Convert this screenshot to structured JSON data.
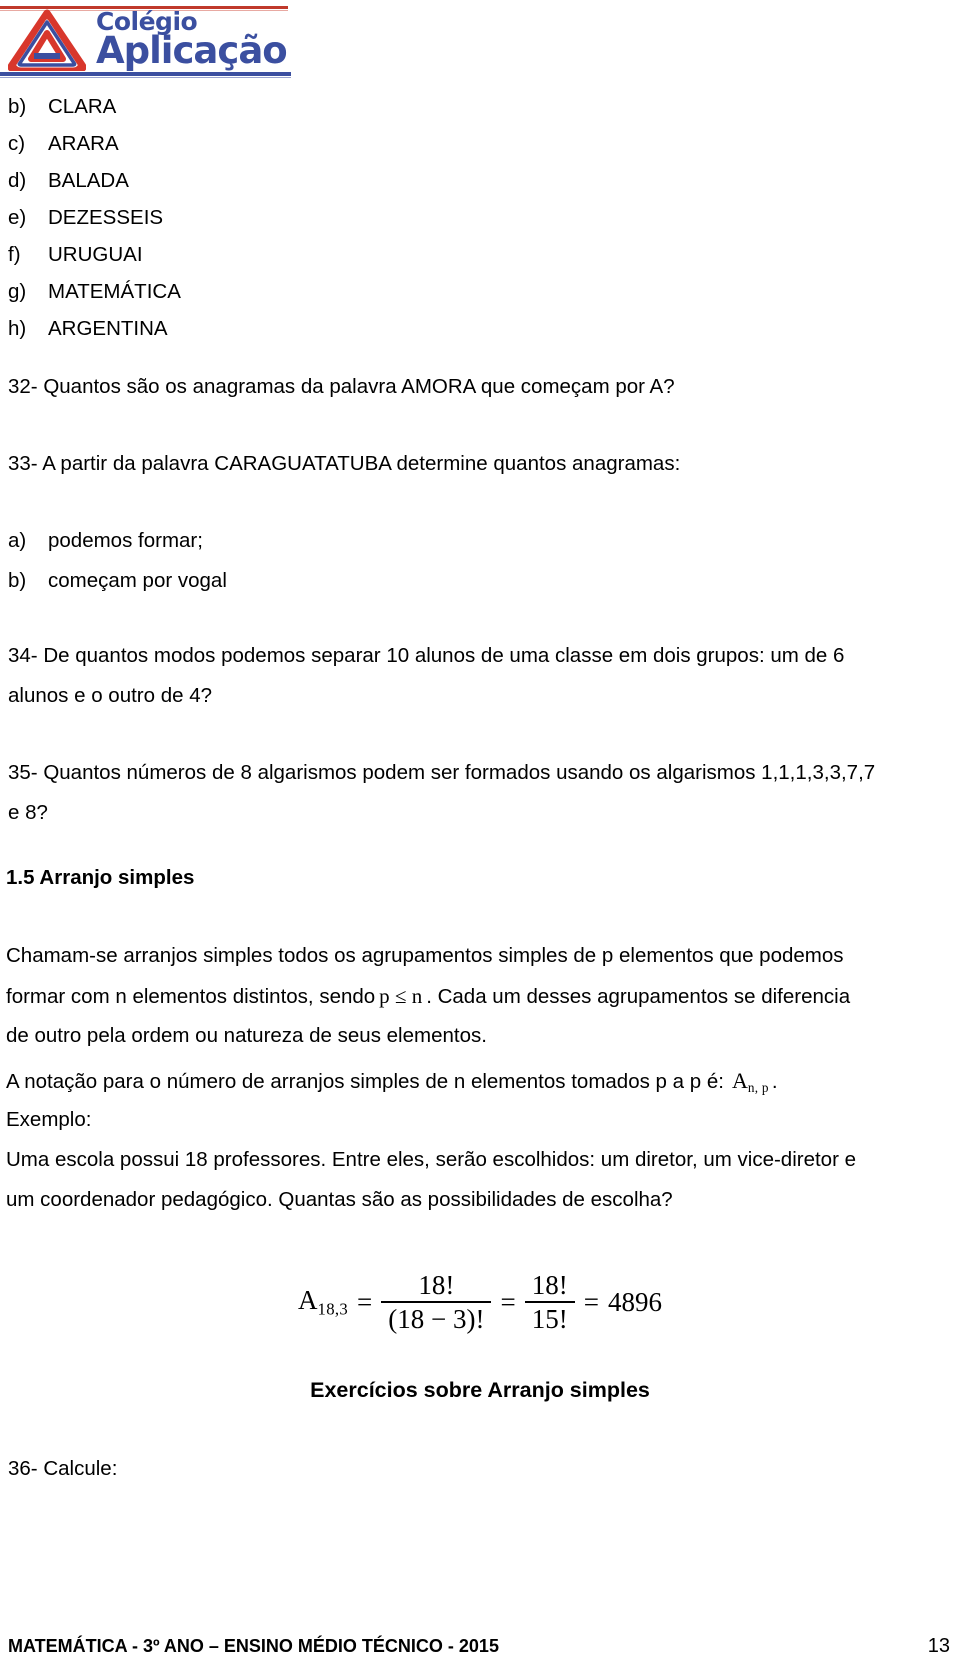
{
  "header": {
    "logo_line1": "Colégio",
    "logo_line2": "Aplicação",
    "logo_mark_name": "triangle-a-logo"
  },
  "answer_list": [
    {
      "mark": "b)",
      "text": "CLARA"
    },
    {
      "mark": "c)",
      "text": "ARARA"
    },
    {
      "mark": "d)",
      "text": "BALADA"
    },
    {
      "mark": "e)",
      "text": "DEZESSEIS"
    },
    {
      "mark": "f)",
      "text": "URUGUAI"
    },
    {
      "mark": "g)",
      "text": "MATEMÁTICA"
    },
    {
      "mark": "h)",
      "text": "ARGENTINA"
    }
  ],
  "questions": {
    "q32": "32- Quantos são os anagramas da palavra AMORA que começam por A?",
    "q33": "33- A partir da palavra CARAGUATATUBA determine quantos anagramas:",
    "q33_a_mark": "a)",
    "q33_a_text": "podemos formar;",
    "q33_b_mark": "b)",
    "q33_b_text": "começam por vogal",
    "q34_line1": "34- De quantos modos podemos separar 10 alunos de uma classe em dois grupos: um de 6",
    "q34_line2": "alunos e o outro de 4?",
    "q35_line1": "35- Quantos números de 8 algarismos podem ser formados usando os algarismos 1,1,1,3,3,7,7",
    "q35_line2": "e 8?",
    "q36": "36- Calcule:"
  },
  "section": {
    "number_title": "1.5 Arranjo simples",
    "p1_line1": "Chamam-se arranjos simples todos os agrupamentos simples de p elementos que podemos",
    "p1_line2_pre": "formar com n elementos distintos, sendo",
    "p1_line2_math": "p ≤ n",
    "p1_line2_post": ". Cada um desses agrupamentos se diferencia",
    "p1_line3": "de outro pela ordem ou natureza de seus elementos.",
    "p2_pre": "A notação para o número de arranjos simples de n elementos tomados p a p é:",
    "p2_symbol_base": "A",
    "p2_symbol_sub": "n, p",
    "p2_post": ".",
    "example_label": "Exemplo:",
    "example_line1": "Uma escola possui 18 professores. Entre eles, serão escolhidos: um diretor, um vice-diretor e",
    "example_line2": "um coordenador pedagógico. Quantas são as possibilidades de escolha?"
  },
  "formula": {
    "lhs_base": "A",
    "lhs_sub": "18,3",
    "eq1": "=",
    "frac1_num": "18!",
    "frac1_den": "(18 − 3)!",
    "eq2": "=",
    "frac2_num": "18!",
    "frac2_den": "15!",
    "eq3": "=",
    "result": "4896"
  },
  "exercises_title": "Exercícios sobre Arranjo simples",
  "footer": {
    "text": "MATEMÁTICA - 3º ANO – ENSINO MÉDIO TÉCNICO - 2015",
    "page_number": "13"
  },
  "colors": {
    "logo_blue": "#3b4fa0",
    "logo_red": "#c0392b",
    "text": "#000000",
    "background": "#ffffff"
  }
}
